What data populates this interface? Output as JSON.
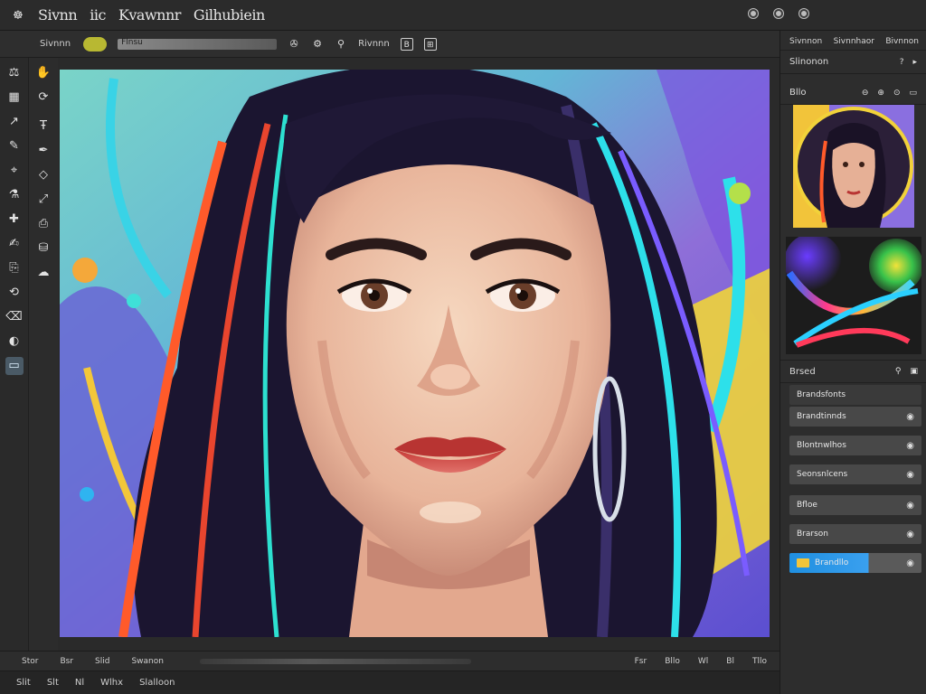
{
  "menubar": {
    "items": [
      "Sivnn",
      "iic",
      "Kvawnnr",
      "Gilhubiein"
    ]
  },
  "options": {
    "tool_label": "Sivnnn",
    "slider_label": "Flnsu",
    "preset_label": "Rivnnn"
  },
  "status": {
    "left": [
      "Stor",
      "Bsr",
      "Slid",
      "Swanon"
    ],
    "right": [
      "Fsr",
      "Bllo",
      "Wl",
      "Bl",
      "Tllo"
    ]
  },
  "bottom": {
    "items": [
      "Slit",
      "Slt",
      "Nl",
      "Wlhx",
      "Slalloon"
    ]
  },
  "rightpanel": {
    "tabs": [
      "Sivnnon",
      "Sivnnhaor",
      "Bivnnon"
    ],
    "section_title": "Slinonon",
    "nav_label": "Bllo",
    "layers_title": "Brsed",
    "layers": [
      {
        "name": "Brandsfonts",
        "kind": "group"
      },
      {
        "name": "Brandtinnds",
        "kind": "layer"
      },
      {
        "name": "Blontnwlhos",
        "kind": "layer"
      },
      {
        "name": "Seonsnlcens",
        "kind": "layer"
      },
      {
        "name": "Bfloe",
        "kind": "layer"
      },
      {
        "name": "Brarson",
        "kind": "layer"
      },
      {
        "name": "Brandllo",
        "kind": "active"
      }
    ]
  },
  "colors": {
    "accent": "#2a9af0",
    "panel": "#2d2d2d",
    "folder": "#f3c53a"
  }
}
